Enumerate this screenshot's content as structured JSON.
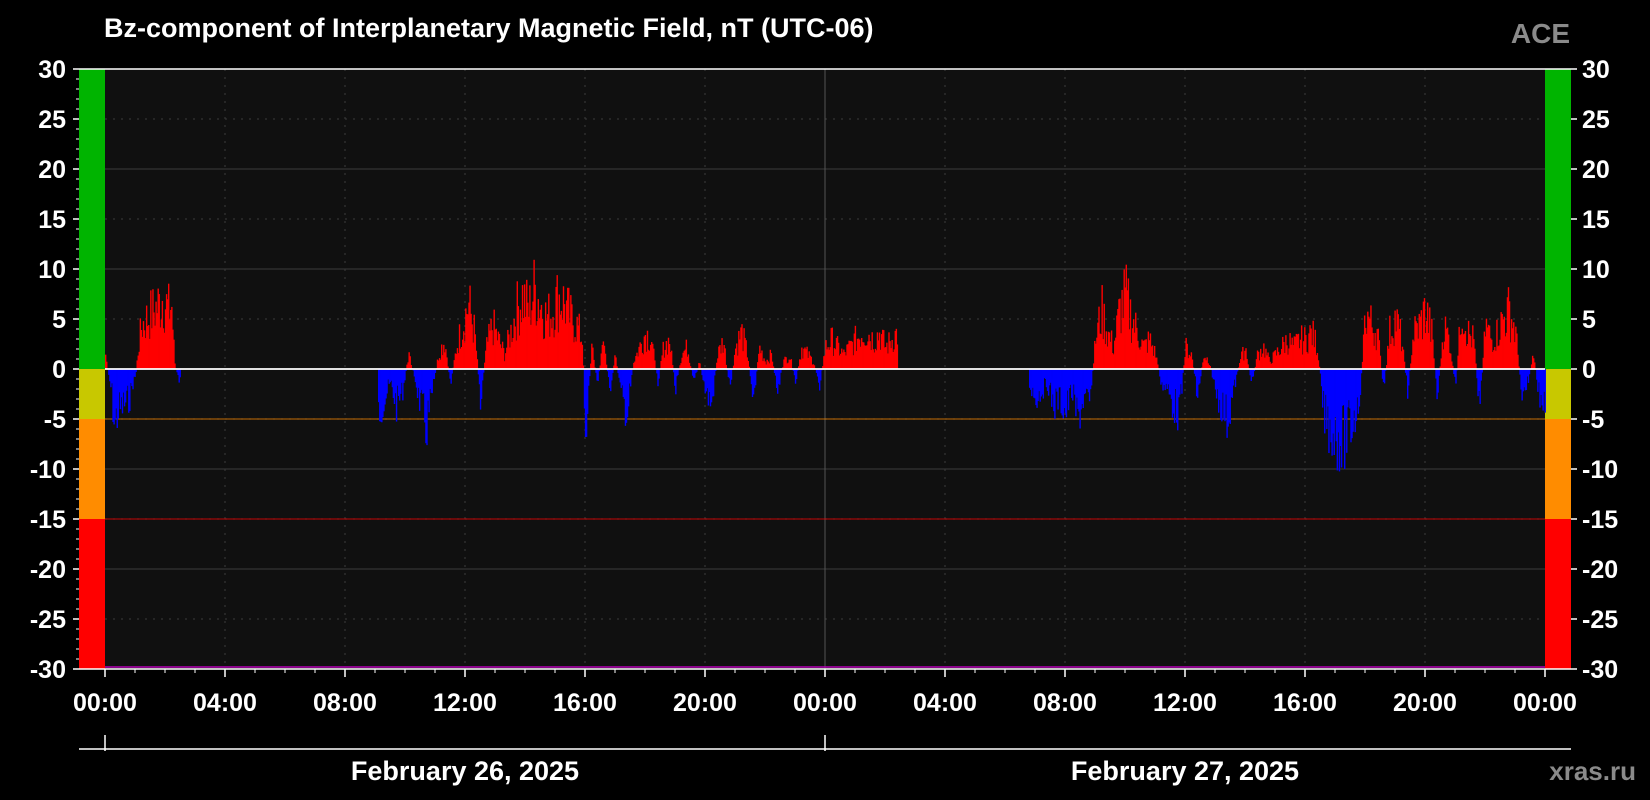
{
  "colors": {
    "background": "#000000",
    "plot_bg": "#101010",
    "positive": "#ff0000",
    "negative": "#0000ff",
    "band_green": "#00b400",
    "band_yellow": "#c8c800",
    "band_orange": "#ff8c00",
    "band_red": "#ff0000",
    "text": "#ffffff",
    "muted": "#8a8a8a"
  },
  "chart_data": {
    "type": "bar",
    "title": "Bz-component of Interplanetary Magnetic Field, nT (UTC-06)",
    "source_label": "ACE",
    "watermark": "xras.ru",
    "ylim": [
      -30,
      30
    ],
    "y_ticks": [
      "30",
      "25",
      "20",
      "15",
      "10",
      "5",
      "0",
      "-5",
      "-10",
      "-15",
      "-20",
      "-25",
      "-30"
    ],
    "x_ticks": [
      "00:00",
      "04:00",
      "08:00",
      "12:00",
      "16:00",
      "20:00",
      "00:00",
      "04:00",
      "08:00",
      "12:00",
      "16:00",
      "20:00",
      "00:00"
    ],
    "x_range_hours": [
      0,
      48
    ],
    "dates": [
      {
        "label": "February 26, 2025",
        "start_hour": 0
      },
      {
        "label": "February 27, 2025",
        "start_hour": 24
      }
    ],
    "threshold_lines": [
      {
        "value": -5,
        "color": "#ff8c00"
      },
      {
        "value": -15,
        "color": "#ff0000"
      }
    ],
    "color_bands": [
      {
        "from": 0,
        "to": 30,
        "color": "#00b400"
      },
      {
        "from": -5,
        "to": 0,
        "color": "#c8c800"
      },
      {
        "from": -15,
        "to": -5,
        "color": "#ff8c00"
      },
      {
        "from": -30,
        "to": -15,
        "color": "#ff0000"
      }
    ],
    "series": [
      {
        "segments": [
          {
            "start_hour": 0.0,
            "end_hour": 2.5,
            "points": [
              [
                0.0,
                2
              ],
              [
                0.1,
                -1
              ],
              [
                0.2,
                -3
              ],
              [
                0.3,
                -8
              ],
              [
                0.4,
                -6
              ],
              [
                0.6,
                -5
              ],
              [
                0.8,
                -4
              ],
              [
                0.9,
                -2
              ],
              [
                1.0,
                -1
              ],
              [
                1.1,
                3
              ],
              [
                1.2,
                6
              ],
              [
                1.4,
                7
              ],
              [
                1.6,
                8
              ],
              [
                1.8,
                9
              ],
              [
                1.9,
                10
              ],
              [
                2.0,
                9
              ],
              [
                2.1,
                8
              ],
              [
                2.2,
                9
              ],
              [
                2.3,
                1
              ],
              [
                2.4,
                -1
              ],
              [
                2.5,
                -2
              ]
            ]
          },
          {
            "start_hour": 9.1,
            "end_hour": 26.4,
            "points": [
              [
                9.1,
                -6
              ],
              [
                9.3,
                -4
              ],
              [
                9.5,
                -2
              ],
              [
                9.7,
                -5
              ],
              [
                9.9,
                -3
              ],
              [
                10.1,
                2
              ],
              [
                10.3,
                -1
              ],
              [
                10.5,
                -5
              ],
              [
                10.7,
                -8
              ],
              [
                10.9,
                -3
              ],
              [
                11.1,
                2
              ],
              [
                11.3,
                4
              ],
              [
                11.5,
                -2
              ],
              [
                11.7,
                3
              ],
              [
                11.9,
                6
              ],
              [
                12.1,
                9
              ],
              [
                12.3,
                5
              ],
              [
                12.5,
                -4
              ],
              [
                12.7,
                3
              ],
              [
                12.9,
                6
              ],
              [
                13.1,
                4
              ],
              [
                13.3,
                2
              ],
              [
                13.5,
                5
              ],
              [
                13.7,
                8
              ],
              [
                13.9,
                10
              ],
              [
                14.1,
                8
              ],
              [
                14.3,
                11
              ],
              [
                14.5,
                9
              ],
              [
                14.7,
                7
              ],
              [
                14.9,
                8
              ],
              [
                15.1,
                10
              ],
              [
                15.3,
                9
              ],
              [
                15.5,
                7
              ],
              [
                15.7,
                6
              ],
              [
                15.9,
                4
              ],
              [
                16.0,
                -9
              ],
              [
                16.2,
                3
              ],
              [
                16.4,
                -2
              ],
              [
                16.6,
                4
              ],
              [
                16.8,
                -3
              ],
              [
                17.0,
                2
              ],
              [
                17.2,
                -4
              ],
              [
                17.4,
                -6
              ],
              [
                17.6,
                1
              ],
              [
                17.8,
                3
              ],
              [
                18.0,
                5
              ],
              [
                18.2,
                4
              ],
              [
                18.4,
                -2
              ],
              [
                18.6,
                3
              ],
              [
                18.8,
                4
              ],
              [
                19.0,
                -3
              ],
              [
                19.2,
                2
              ],
              [
                19.4,
                3
              ],
              [
                19.6,
                -2
              ],
              [
                19.8,
                1
              ],
              [
                20.0,
                -3
              ],
              [
                20.2,
                -5
              ],
              [
                20.4,
                2
              ],
              [
                20.6,
                4
              ],
              [
                20.8,
                -3
              ],
              [
                21.0,
                3
              ],
              [
                21.2,
                5
              ],
              [
                21.4,
                2
              ],
              [
                21.6,
                -4
              ],
              [
                21.8,
                3
              ],
              [
                22.0,
                1
              ],
              [
                22.2,
                2
              ],
              [
                22.4,
                -3
              ],
              [
                22.6,
                1
              ],
              [
                22.8,
                2
              ],
              [
                23.0,
                -2
              ],
              [
                23.2,
                3
              ],
              [
                23.4,
                2
              ],
              [
                23.6,
                1
              ],
              [
                23.8,
                -2
              ],
              [
                24.0,
                3
              ],
              [
                24.2,
                4
              ],
              [
                24.4,
                3
              ],
              [
                24.6,
                2
              ],
              [
                24.8,
                3
              ],
              [
                25.0,
                4
              ],
              [
                25.2,
                5
              ],
              [
                25.4,
                5
              ],
              [
                25.6,
                4
              ],
              [
                25.8,
                5
              ],
              [
                26.0,
                3
              ],
              [
                26.2,
                4
              ],
              [
                26.4,
                5
              ]
            ]
          },
          {
            "start_hour": 30.8,
            "end_hour": 48.0,
            "points": [
              [
                30.8,
                -2
              ],
              [
                31.0,
                -4
              ],
              [
                31.2,
                -3
              ],
              [
                31.4,
                -2
              ],
              [
                31.6,
                -5
              ],
              [
                31.8,
                -4
              ],
              [
                32.0,
                -6
              ],
              [
                32.2,
                -3
              ],
              [
                32.4,
                -7
              ],
              [
                32.6,
                -4
              ],
              [
                32.8,
                -5
              ],
              [
                33.0,
                4
              ],
              [
                33.2,
                8
              ],
              [
                33.4,
                5
              ],
              [
                33.6,
                3
              ],
              [
                33.8,
                8
              ],
              [
                34.0,
                10
              ],
              [
                34.2,
                7
              ],
              [
                34.4,
                5
              ],
              [
                34.6,
                3
              ],
              [
                34.8,
                4
              ],
              [
                35.0,
                2
              ],
              [
                35.2,
                -2
              ],
              [
                35.4,
                -3
              ],
              [
                35.6,
                -5
              ],
              [
                35.8,
                -6
              ],
              [
                36.0,
                3
              ],
              [
                36.2,
                2
              ],
              [
                36.4,
                -4
              ],
              [
                36.6,
                2
              ],
              [
                36.8,
                1
              ],
              [
                37.0,
                -3
              ],
              [
                37.2,
                -5
              ],
              [
                37.4,
                -7
              ],
              [
                37.6,
                -3
              ],
              [
                37.8,
                1
              ],
              [
                38.0,
                3
              ],
              [
                38.2,
                -2
              ],
              [
                38.4,
                2
              ],
              [
                38.6,
                3
              ],
              [
                38.8,
                1
              ],
              [
                39.0,
                2
              ],
              [
                39.2,
                3
              ],
              [
                39.4,
                4
              ],
              [
                39.6,
                3
              ],
              [
                39.8,
                4
              ],
              [
                40.0,
                4
              ],
              [
                40.2,
                5
              ],
              [
                40.4,
                3
              ],
              [
                40.6,
                -6
              ],
              [
                40.8,
                -8
              ],
              [
                41.0,
                -9
              ],
              [
                41.2,
                -10
              ],
              [
                41.4,
                -9
              ],
              [
                41.6,
                -7
              ],
              [
                41.8,
                -4
              ],
              [
                42.0,
                8
              ],
              [
                42.2,
                6
              ],
              [
                42.4,
                5
              ],
              [
                42.6,
                -3
              ],
              [
                42.8,
                5
              ],
              [
                43.0,
                7
              ],
              [
                43.2,
                4
              ],
              [
                43.4,
                -3
              ],
              [
                43.6,
                5
              ],
              [
                43.8,
                6
              ],
              [
                44.0,
                8
              ],
              [
                44.2,
                5
              ],
              [
                44.4,
                -4
              ],
              [
                44.6,
                6
              ],
              [
                44.8,
                4
              ],
              [
                45.0,
                -3
              ],
              [
                45.2,
                9
              ],
              [
                45.4,
                5
              ],
              [
                45.6,
                4
              ],
              [
                45.8,
                -5
              ],
              [
                46.0,
                6
              ],
              [
                46.2,
                4
              ],
              [
                46.4,
                5
              ],
              [
                46.6,
                7
              ],
              [
                46.8,
                8
              ],
              [
                47.0,
                5
              ],
              [
                47.2,
                -3
              ],
              [
                47.4,
                -2
              ],
              [
                47.6,
                2
              ],
              [
                47.8,
                -4
              ],
              [
                48.0,
                -5
              ]
            ]
          }
        ]
      }
    ]
  }
}
